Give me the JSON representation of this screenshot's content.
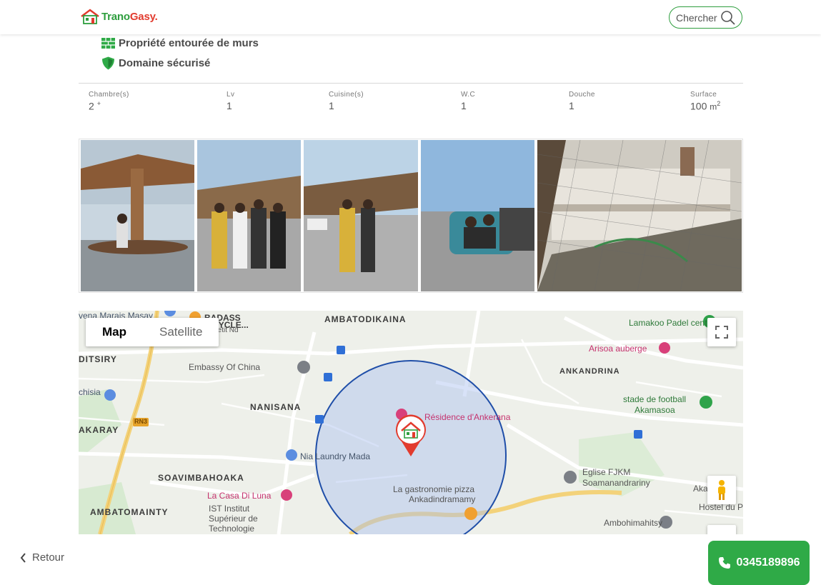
{
  "header": {
    "logo_part1": "Trano",
    "logo_part2": "Gasy.",
    "search_label": "Chercher"
  },
  "features": [
    {
      "label": "Propriété entourée de murs",
      "icon": "wall-icon"
    },
    {
      "label": "Domaine sécurisé",
      "icon": "shield-icon"
    }
  ],
  "specs": [
    {
      "label": "Chambre(s)",
      "value": "2",
      "suffix": "+"
    },
    {
      "label": "Lv",
      "value": "1"
    },
    {
      "label": "Cuisine(s)",
      "value": "1"
    },
    {
      "label": "W.C",
      "value": "1"
    },
    {
      "label": "Douche",
      "value": "1"
    },
    {
      "label": "Surface",
      "value": "100",
      "unit": "m",
      "unit_sup": "2"
    }
  ],
  "gallery": {
    "photos": [
      "photo-1",
      "photo-2",
      "photo-3",
      "photo-4",
      "photo-5"
    ]
  },
  "map": {
    "type_options": [
      "Map",
      "Satellite"
    ],
    "selected_type": "Map",
    "labels": {
      "marais": "vena Marais Masay",
      "badass": "BADASS",
      "motorcycle": "TORCYCLE...",
      "ambatodikaina": "AMBATODIKAINA",
      "lamakoo": "Lamakoo Padel center",
      "petit_nd": "Petit Nd",
      "arisoa": "Arisoa auberge",
      "ditsiry": "DITSIRY",
      "embassy": "Embassy Of China",
      "ankandrina": "ANKANDRINA",
      "chisia": "chisia",
      "nanisana": "NANISANA",
      "residence": "Résidence d'Ankerana",
      "stade1": "stade de football",
      "stade2": "Akamasoa",
      "rn3": "RN3",
      "akaray": "AKARAY",
      "nia": "Nia Laundry Mada",
      "soavimbahoaka": "SOAVIMBAHOAKA",
      "eglise1": "Eglise FJKM",
      "eglise2": "Soamanandrariny",
      "akamasoa_r": "Akamasoa",
      "casa": "La Casa Di Luna",
      "pizza1": "La gastronomie pizza",
      "pizza2": "Ankadindramamy",
      "hostel": "Hostel du Père",
      "ambatomainty": "AMBATOMAINTY",
      "ist1": "IST Institut",
      "ist2": "Supérieur de",
      "ist3": "Technologie",
      "ambohimahitsy": "Ambohimahitsy"
    }
  },
  "footer": {
    "back_label": "Retour",
    "phone": "0345189896"
  },
  "colors": {
    "brand_green": "#2faa47",
    "brand_red": "#e23b2e",
    "radius_fill": "#a9bff0",
    "radius_stroke": "#1f4ea8"
  }
}
